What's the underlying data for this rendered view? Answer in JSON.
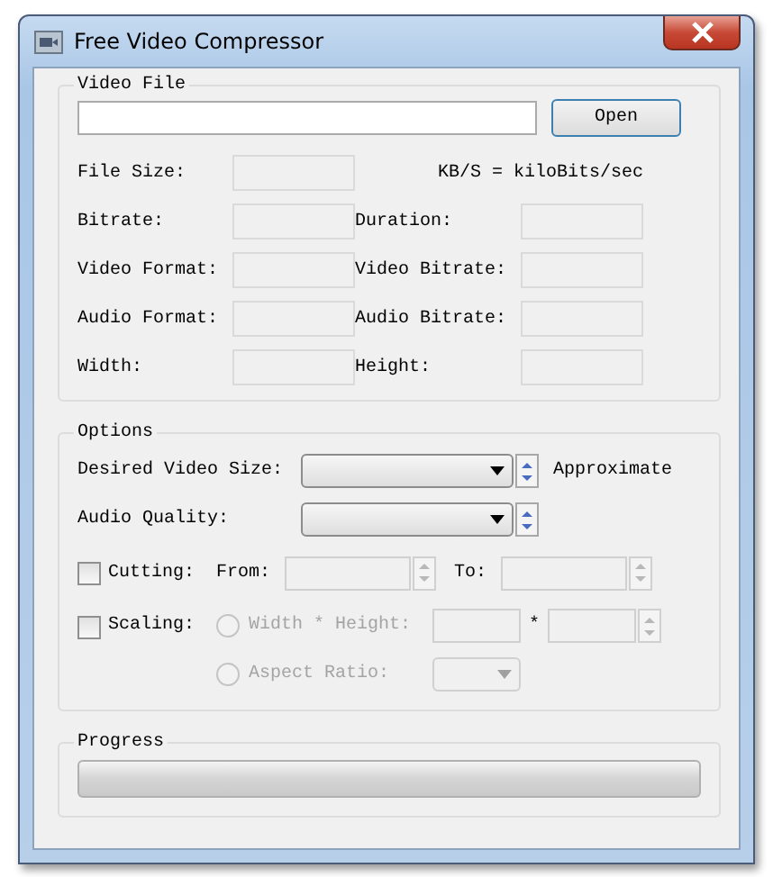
{
  "window": {
    "title": "Free Video Compressor"
  },
  "video_file": {
    "title": "Video File",
    "open_button": "Open",
    "note": "KB/S = kiloBits/sec",
    "info": [
      {
        "label": "File Size:"
      },
      {
        "label": "Bitrate:"
      },
      {
        "label": "Duration:"
      },
      {
        "label": "Video Format:"
      },
      {
        "label": "Video Bitrate:"
      },
      {
        "label": "Audio Format:"
      },
      {
        "label": "Audio Bitrate:"
      },
      {
        "label": "Width:"
      },
      {
        "label": "Height:"
      }
    ]
  },
  "options": {
    "title": "Options",
    "desired_video_size": {
      "label": "Desired Video Size:",
      "suffix": "Approximate"
    },
    "audio_quality": {
      "label": "Audio Quality:"
    },
    "cutting": {
      "label": "Cutting:",
      "checked": false,
      "from_label": "From:",
      "to_label": "To:"
    },
    "scaling": {
      "label": "Scaling:",
      "checked": false,
      "separator": "*",
      "modes": [
        {
          "label": "Width * Height:",
          "selected": false,
          "disabled": true
        },
        {
          "label": "Aspect Ratio:",
          "selected": false,
          "disabled": true
        }
      ]
    }
  },
  "progress": {
    "title": "Progress"
  }
}
